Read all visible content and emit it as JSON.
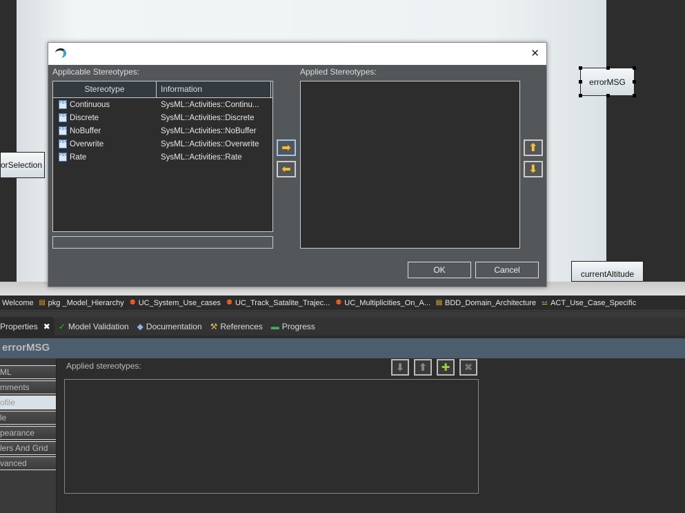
{
  "diagram": {
    "nodes": [
      {
        "label": "sorSelection"
      },
      {
        "label": "errorMSG"
      },
      {
        "label": "currentAltitude"
      }
    ]
  },
  "editor_tabs": [
    {
      "label": "Welcome",
      "icon": ""
    },
    {
      "label": "pkg _Model_Hierarchy",
      "icon": "package-diagram-icon"
    },
    {
      "label": "UC_System_Use_cases",
      "icon": "use-case-diagram-icon"
    },
    {
      "label": "UC_Track_Satalite_Trajec...",
      "icon": "use-case-diagram-icon"
    },
    {
      "label": "UC_Multiplicities_On_A...",
      "icon": "use-case-diagram-icon"
    },
    {
      "label": "BDD_Domain_Architecture",
      "icon": "bdd-diagram-icon"
    },
    {
      "label": "ACT_Use_Case_Specific",
      "icon": "activity-diagram-icon"
    }
  ],
  "property_tabs": [
    {
      "label": "Properties",
      "icon": "",
      "active": true
    },
    {
      "label": "Model Validation",
      "icon": "checkmark-icon"
    },
    {
      "label": "Documentation",
      "icon": "book-icon"
    },
    {
      "label": "References",
      "icon": "references-icon"
    },
    {
      "label": "Progress",
      "icon": "progress-icon"
    }
  ],
  "properties": {
    "title": "errorMSG",
    "sections": [
      "ML",
      "mments",
      "ofile",
      "le",
      "pearance",
      "lers And Grid",
      "vanced"
    ],
    "selected_section": "ofile",
    "applied_label": "Applied stereotypes:"
  },
  "dialog": {
    "applicable_label": "Applicable Stereotypes:",
    "applied_label": "Applied Stereotypes:",
    "columns": [
      "Stereotype",
      "Information"
    ],
    "rows": [
      {
        "name": "Continuous",
        "info": "SysML::Activities::Continu..."
      },
      {
        "name": "Discrete",
        "info": "SysML::Activities::Discrete"
      },
      {
        "name": "NoBuffer",
        "info": "SysML::Activities::NoBuffer"
      },
      {
        "name": "Overwrite",
        "info": "SysML::Activities::Overwrite"
      },
      {
        "name": "Rate",
        "info": "SysML::Activities::Rate"
      }
    ],
    "ok_label": "OK",
    "cancel_label": "Cancel",
    "close_glyph": "✕"
  },
  "colors": {
    "header": "#4c5d6e",
    "arrow": "#f4c030",
    "add": "#9ad040"
  }
}
